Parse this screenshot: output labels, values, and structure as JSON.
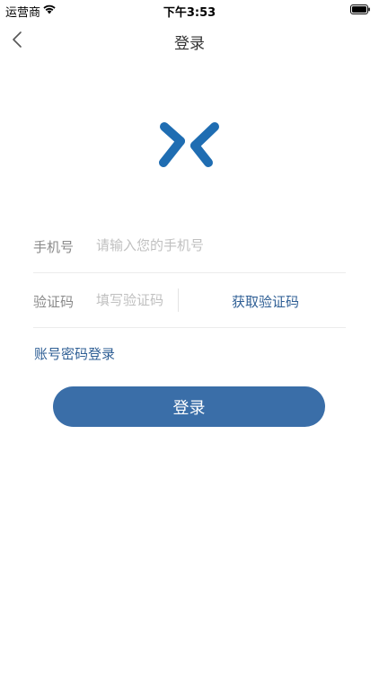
{
  "status_bar": {
    "carrier": "运营商",
    "time": "下午3:53",
    "wifi_icon": "wifi-icon",
    "battery_icon": "battery-icon"
  },
  "nav": {
    "back_icon": "chevron-left-icon",
    "title": "登录"
  },
  "logo": {
    "icon": "brand-logo-icon",
    "color": "#1f6db2"
  },
  "form": {
    "phone": {
      "label": "手机号",
      "value": "",
      "placeholder": "请输入您的手机号"
    },
    "code": {
      "label": "验证码",
      "value": "",
      "placeholder": "填写验证码",
      "get_code_label": "获取验证码"
    }
  },
  "password_login_link": "账号密码登录",
  "login_button": "登录",
  "colors": {
    "accent": "#3a6ea8",
    "link": "#2f5f95"
  }
}
